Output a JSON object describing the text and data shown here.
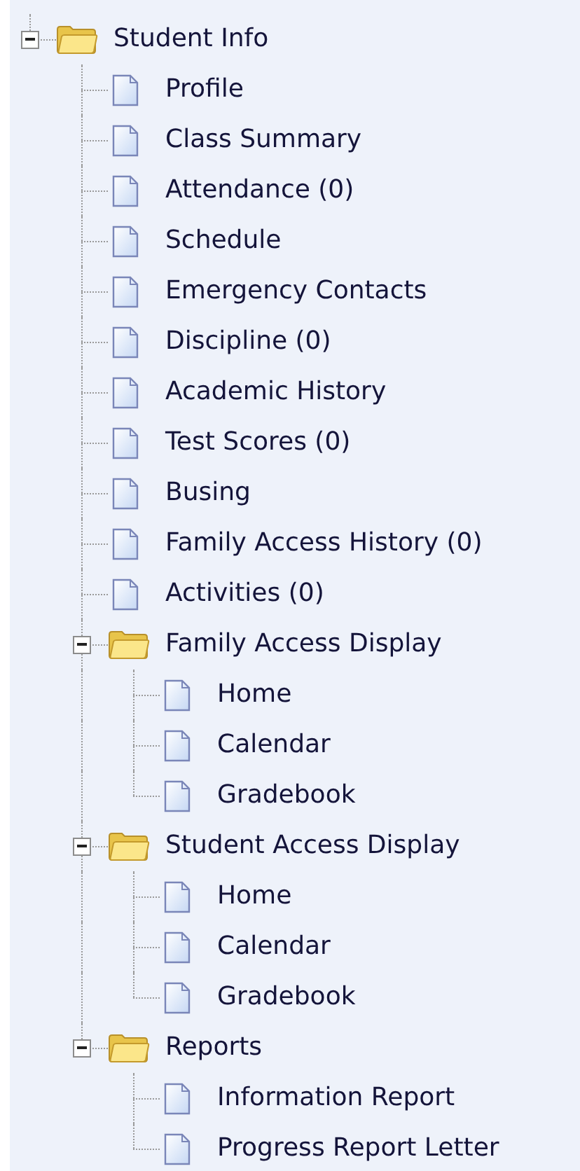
{
  "tree": [
    {
      "kind": "folder",
      "label": "Student Info",
      "expanded": true,
      "children": [
        {
          "kind": "page",
          "label": "Profile"
        },
        {
          "kind": "page",
          "label": "Class Summary"
        },
        {
          "kind": "page",
          "label": "Attendance (0)"
        },
        {
          "kind": "page",
          "label": "Schedule"
        },
        {
          "kind": "page",
          "label": "Emergency Contacts"
        },
        {
          "kind": "page",
          "label": "Discipline (0)"
        },
        {
          "kind": "page",
          "label": "Academic History"
        },
        {
          "kind": "page",
          "label": "Test Scores (0)"
        },
        {
          "kind": "page",
          "label": "Busing"
        },
        {
          "kind": "page",
          "label": "Family Access History (0)"
        },
        {
          "kind": "page",
          "label": "Activities (0)"
        },
        {
          "kind": "folder",
          "label": "Family Access Display",
          "expanded": true,
          "children": [
            {
              "kind": "page",
              "label": "Home"
            },
            {
              "kind": "page",
              "label": "Calendar"
            },
            {
              "kind": "page",
              "label": "Gradebook"
            }
          ]
        },
        {
          "kind": "folder",
          "label": "Student Access Display",
          "expanded": true,
          "children": [
            {
              "kind": "page",
              "label": "Home"
            },
            {
              "kind": "page",
              "label": "Calendar"
            },
            {
              "kind": "page",
              "label": "Gradebook"
            }
          ]
        },
        {
          "kind": "folder",
          "label": "Reports",
          "expanded": true,
          "children": [
            {
              "kind": "page",
              "label": "Information Report"
            },
            {
              "kind": "page",
              "label": "Progress Report Letter"
            }
          ]
        }
      ]
    }
  ]
}
